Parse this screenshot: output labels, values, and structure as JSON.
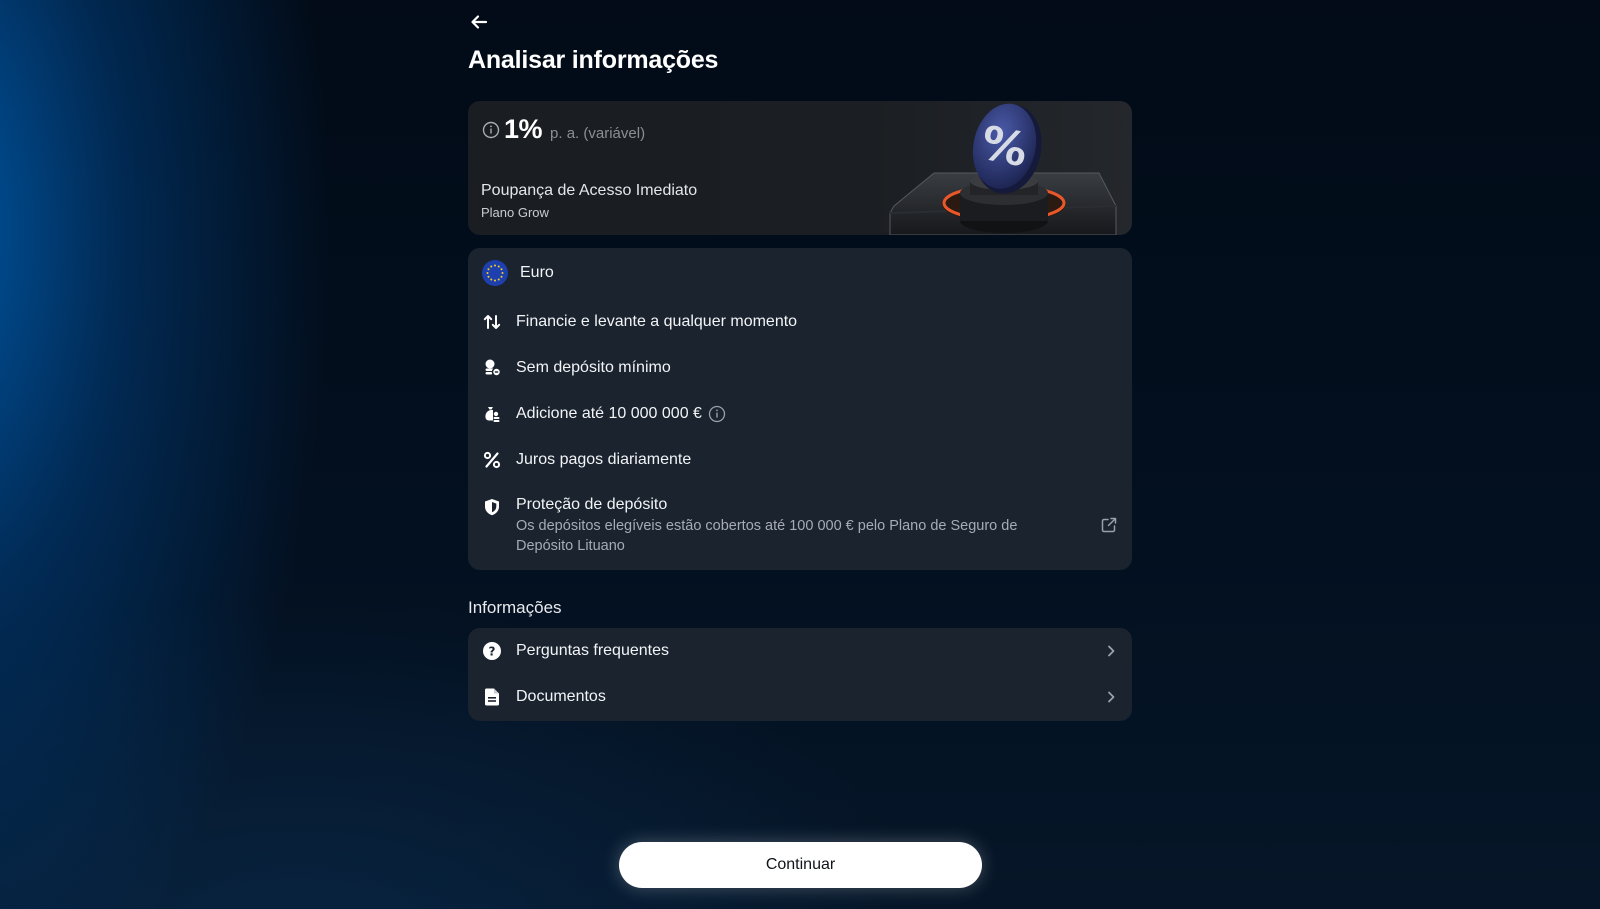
{
  "header": {
    "back_icon": "arrow-left-icon",
    "title": "Analisar informações"
  },
  "product": {
    "rate": "1%",
    "rate_suffix": "p. a. (variável)",
    "name": "Poupança de Acesso Imediato",
    "plan": "Plano Grow",
    "accent_color": "#e8582a"
  },
  "features": {
    "currency": "Euro",
    "items": [
      {
        "icon": "arrows-up-down-icon",
        "label": "Financie e levante a qualquer momento"
      },
      {
        "icon": "coins-icon",
        "label": "Sem depósito mínimo"
      },
      {
        "icon": "money-bag-icon",
        "label": "Adicione até 10 000 000 €"
      },
      {
        "icon": "percent-icon",
        "label": "Juros pagos diariamente"
      }
    ],
    "protection": {
      "title": "Proteção de depósito",
      "description_line1": "Os depósitos elegíveis estão cobertos até 100 000 € pelo Plano de Seguro de",
      "description_line2": "Depósito Lituano"
    }
  },
  "info_section": {
    "title": "Informações",
    "rows": [
      {
        "icon": "question-circle-icon",
        "label": "Perguntas frequentes"
      },
      {
        "icon": "document-icon",
        "label": "Documentos"
      }
    ]
  },
  "footer": {
    "continue_label": "Continuar"
  }
}
